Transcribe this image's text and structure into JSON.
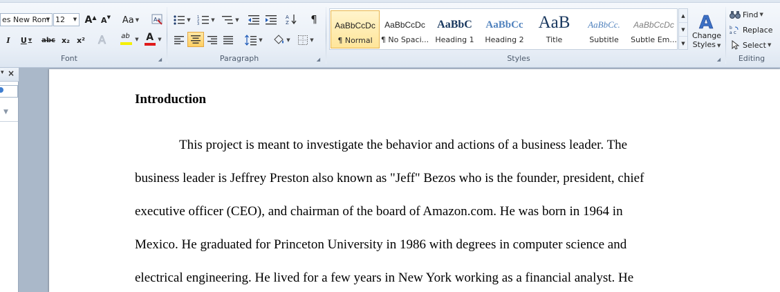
{
  "ribbon": {
    "font_group": {
      "label": "Font",
      "font_name": "es New Rom",
      "font_size": "12",
      "grow_font": "A",
      "shrink_font": "A",
      "change_case": "Aa",
      "italic": "I",
      "underline": "U",
      "strikethrough": "abc",
      "subscript": "x₂",
      "superscript": "x²",
      "highlight": "ab",
      "font_color": "A"
    },
    "paragraph_group": {
      "label": "Paragraph"
    },
    "styles_group": {
      "label": "Styles",
      "items": [
        {
          "sample": "AaBbCcDc",
          "name": "¶ Normal"
        },
        {
          "sample": "AaBbCcDc",
          "name": "¶ No Spaci..."
        },
        {
          "sample": "AaBbC",
          "name": "Heading 1"
        },
        {
          "sample": "AaBbCc",
          "name": "Heading 2"
        },
        {
          "sample": "AaB",
          "name": "Title"
        },
        {
          "sample": "AaBbCc.",
          "name": "Subtitle"
        },
        {
          "sample": "AaBbCcDc",
          "name": "Subtle Em..."
        }
      ],
      "change_styles_line1": "Change",
      "change_styles_line2": "Styles"
    },
    "editing_group": {
      "label": "Editing",
      "find": "Find",
      "replace": "Replace",
      "select": "Select"
    }
  },
  "document": {
    "heading": "Introduction",
    "lines": [
      "This project is meant to investigate the behavior and actions of a business leader. The",
      "business leader is Jeffrey Preston also known as \"Jeff\" Bezos who is the founder, president, chief",
      "executive officer (CEO), and chairman of the board of Amazon.com. He was born in 1964 in",
      "Mexico. He graduated for Princeton University in 1986 with degrees in computer science and",
      "electrical engineering. He lived for a few years in New York working as a financial analyst. He"
    ]
  },
  "colors": {
    "ribbon_bg": "#e9eff7",
    "active_highlight": "#ffe59a",
    "heading_blue": "#17365d",
    "workspace": "#acb9ca",
    "font_color_red": "#e01b1b",
    "highlight_yellow": "#f5f000"
  }
}
